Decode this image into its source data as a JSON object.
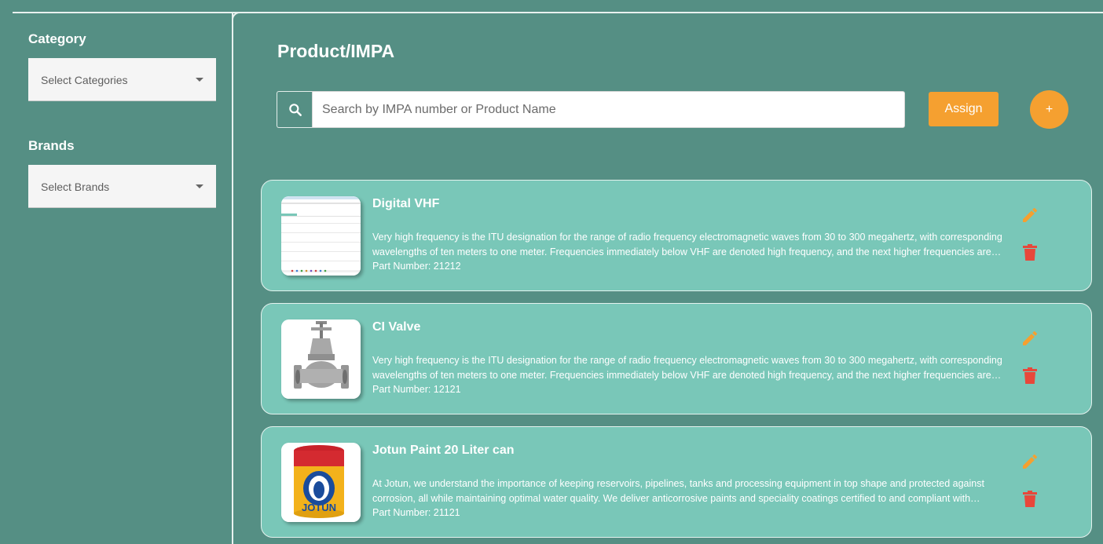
{
  "sidebar": {
    "category": {
      "label": "Category",
      "placeholder": "Select Categories"
    },
    "brands": {
      "label": "Brands",
      "placeholder": "Select Brands"
    }
  },
  "main": {
    "title": "Product/IMPA",
    "search": {
      "placeholder": "Search by IMPA number or Product Name"
    },
    "assign_label": "Assign",
    "add_label": "+"
  },
  "products": [
    {
      "name": "Digital VHF",
      "description": "Very high frequency is the ITU designation for the range of radio frequency electromagnetic waves from 30 to 300 megahertz, with corresponding wavelengths of ten meters to one meter. Frequencies immediately below VHF are denoted high frequency, and the next higher frequencies are known as ultra high frequency.",
      "part_number": "Part Number: 21212"
    },
    {
      "name": "CI Valve",
      "description": "Very high frequency is the ITU designation for the range of radio frequency electromagnetic waves from 30 to 300 megahertz, with corresponding wavelengths of ten meters to one meter. Frequencies immediately below VHF are denoted high frequency, and the next higher frequencies are known as ultra high frequency.",
      "part_number": "Part Number: 12121"
    },
    {
      "name": "Jotun Paint 20 Liter can",
      "description": "At Jotun, we understand the importance of keeping reservoirs, pipelines, tanks and processing equipment in top shape and protected against corrosion, all while maintaining optimal water quality. We deliver anticorrosive paints and speciality coatings certified to and compliant with international standards.",
      "part_number": "Part Number: 21121"
    }
  ],
  "paint_label": "JOTUN",
  "colors": {
    "background": "#558f84",
    "card": "#79c7b8",
    "accent": "#f5a030",
    "delete": "#e8473a"
  },
  "icons": {
    "search": "search-icon",
    "edit": "pencil-icon",
    "delete": "trash-icon",
    "dropdown": "caret-down-icon"
  }
}
